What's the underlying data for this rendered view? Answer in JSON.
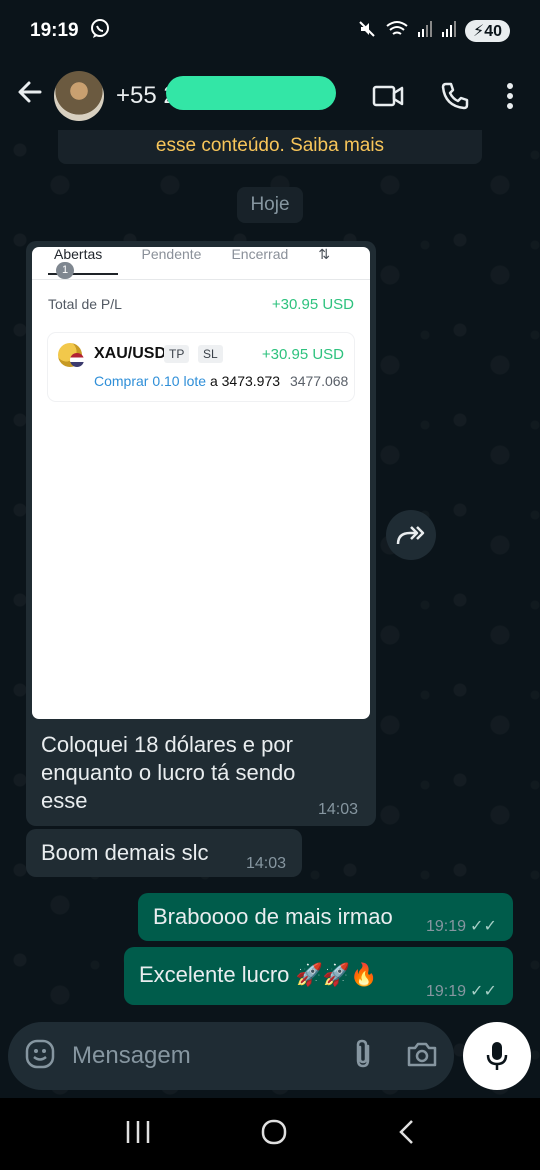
{
  "status_bar": {
    "time": "19:19",
    "battery": "40"
  },
  "header": {
    "contact_name": "+55 2                    3"
  },
  "encryption_banner": "esse conteúdo. Saiba mais",
  "date_divider": "Hoje",
  "screenshot_card": {
    "tabs": [
      {
        "label": "Abertas",
        "badge": "1"
      },
      {
        "label": "Pendente"
      },
      {
        "label": "Encerrad"
      }
    ],
    "total_pl_label": "Total de P/L",
    "total_pl_value": "+30.95 USD",
    "position": {
      "symbol": "XAU/USD",
      "tag_tp": "TP",
      "tag_sl": "SL",
      "pl": "+30.95 USD",
      "action": "Comprar 0.10 lote",
      "at": "a",
      "entry": "3473.973",
      "current": "3477.068"
    }
  },
  "messages": [
    {
      "direction": "in",
      "text_line1": "Coloquei 18 dólares e por",
      "text_line2": "enquanto o lucro tá sendo",
      "text_line3": "esse",
      "time": "14:03"
    },
    {
      "direction": "in",
      "text": "Boom demais slc",
      "time": "14:03"
    },
    {
      "direction": "out",
      "text": "Braboooo de mais irmao",
      "time": "19:19"
    },
    {
      "direction": "out",
      "text": "Excelente lucro 🚀🚀🔥",
      "time": "19:19"
    }
  ],
  "composer": {
    "placeholder": "Mensagem"
  },
  "icons": {
    "back": "arrow-left-icon",
    "video": "video-call-icon",
    "call": "phone-icon",
    "menu": "more-vert-icon",
    "forward": "forward-icon",
    "emoji": "emoji-icon",
    "attach": "paperclip-icon",
    "camera": "camera-icon",
    "mic": "mic-icon"
  },
  "colors": {
    "background": "#0b141a",
    "incoming_bubble": "#202c33",
    "outgoing_bubble": "#005c4b",
    "banner_text": "#f7c55a",
    "profit_green": "#2ec27e"
  }
}
